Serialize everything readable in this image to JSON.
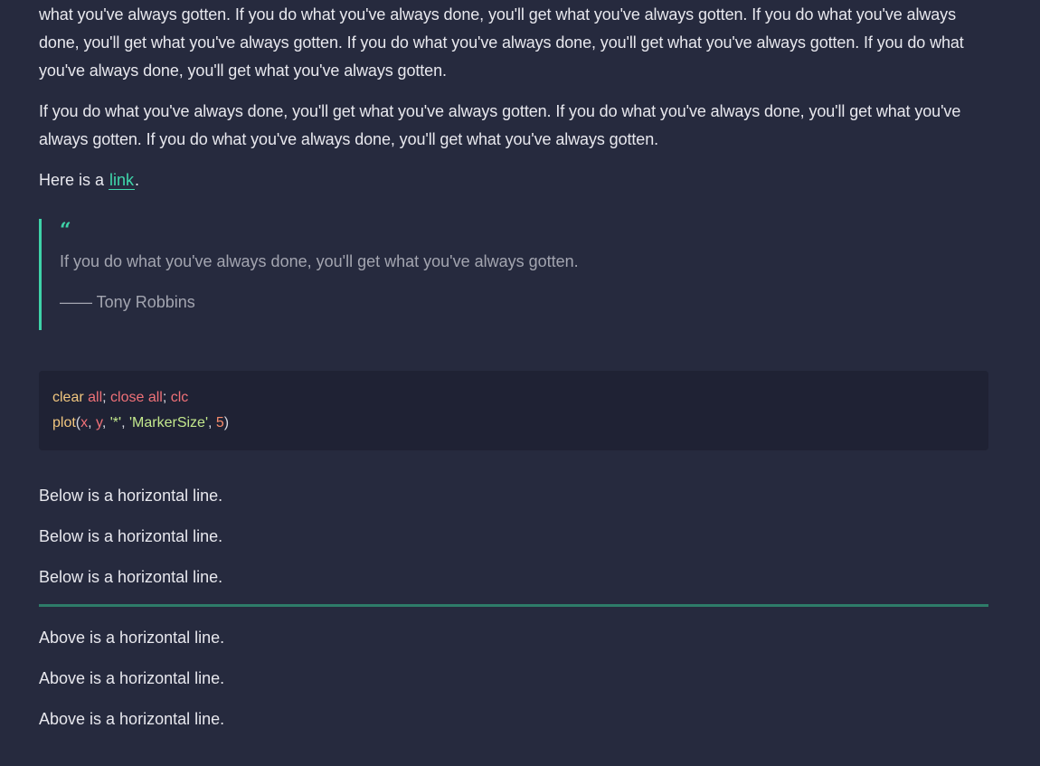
{
  "paragraphs": [
    "what you've always gotten. If you do what you've always done, you'll get what you've always gotten. If you do what you've always done, you'll get what you've always gotten. If you do what you've always done, you'll get what you've always gotten. If you do what you've always done, you'll get what you've always gotten.",
    "If you do what you've always done, you'll get what you've always gotten. If you do what you've always done, you'll get what you've always gotten. If you do what you've always done, you'll get what you've always gotten."
  ],
  "link_line": {
    "prefix": "Here is a ",
    "link_text": "link",
    "suffix": "."
  },
  "blockquote": {
    "mark": "“",
    "text": "If you do what you've always done, you'll get what you've always gotten.",
    "author": "—— Tony Robbins"
  },
  "code": {
    "line1": [
      "clear",
      " all",
      ";",
      " close all",
      ";",
      " clc"
    ],
    "line2": [
      "plot",
      "(",
      "x",
      ",",
      " y",
      ",",
      " '*'",
      ",",
      " 'MarkerSize'",
      ",",
      " 5",
      ")"
    ]
  },
  "below_lines": [
    "Below is a horizontal line.",
    "Below is a horizontal line.",
    "Below is a horizontal line."
  ],
  "above_lines": [
    "Above is a horizontal line.",
    "Above is a horizontal line.",
    "Above is a horizontal line."
  ],
  "colors": {
    "background": "#262a3e",
    "accent": "#3ed3a8",
    "rule": "#2e7c69",
    "code_bg": "#1f2234"
  }
}
